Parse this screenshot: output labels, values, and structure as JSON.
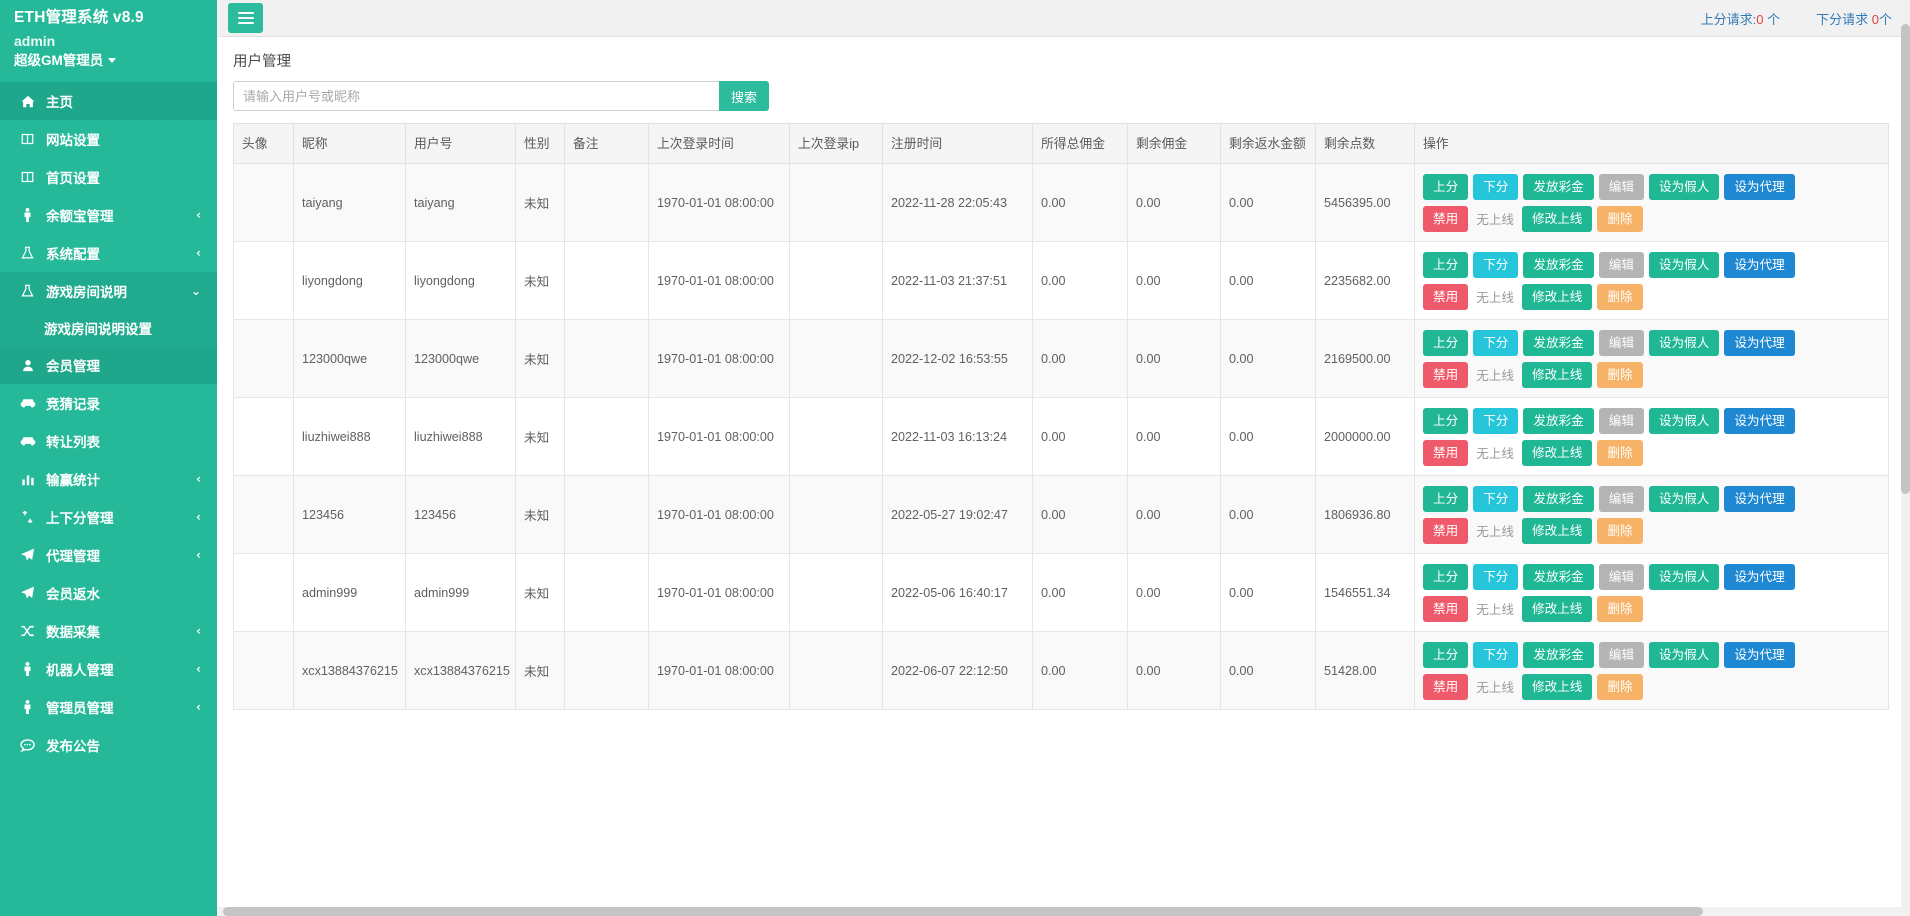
{
  "sidebar": {
    "brand": "ETH管理系统 v8.9",
    "user": "admin",
    "role": "超级GM管理员",
    "items": [
      {
        "label": "主页",
        "icon": "home-icon",
        "arrow": "",
        "active": true
      },
      {
        "label": "网站设置",
        "icon": "window-icon",
        "arrow": ""
      },
      {
        "label": "首页设置",
        "icon": "window-icon",
        "arrow": ""
      },
      {
        "label": "余额宝管理",
        "icon": "person-icon",
        "arrow": "‹"
      },
      {
        "label": "系统配置",
        "icon": "flask-icon",
        "arrow": "‹"
      },
      {
        "label": "游戏房间说明",
        "icon": "flask-icon",
        "arrow": "⌄",
        "expanded": true
      },
      {
        "label": "会员管理",
        "icon": "user-icon",
        "arrow": "",
        "active": true
      },
      {
        "label": "竞猜记录",
        "icon": "car-icon",
        "arrow": ""
      },
      {
        "label": "转让列表",
        "icon": "car-icon",
        "arrow": ""
      },
      {
        "label": "输赢统计",
        "icon": "chart-icon",
        "arrow": "‹"
      },
      {
        "label": "上下分管理",
        "icon": "updown-icon",
        "arrow": "‹"
      },
      {
        "label": "代理管理",
        "icon": "paperplane-icon",
        "arrow": "‹"
      },
      {
        "label": "会员返水",
        "icon": "paperplane-icon",
        "arrow": ""
      },
      {
        "label": "数据采集",
        "icon": "shuffle-icon",
        "arrow": "‹"
      },
      {
        "label": "机器人管理",
        "icon": "person-icon",
        "arrow": "‹"
      },
      {
        "label": "管理员管理",
        "icon": "person-icon",
        "arrow": "‹"
      },
      {
        "label": "发布公告",
        "icon": "comment-icon",
        "arrow": ""
      }
    ],
    "submenu": {
      "parent": "游戏房间说明",
      "items": [
        "游戏房间说明设置"
      ]
    }
  },
  "topbar": {
    "menu_toggle": "hamburger-icon",
    "up_request_label": "上分请求:",
    "up_request_count": "0",
    "up_request_unit": "个",
    "down_request_label": "下分请求",
    "down_request_count": "0",
    "down_request_unit": "个"
  },
  "page": {
    "title": "用户管理"
  },
  "search": {
    "placeholder": "请输入用户号或昵称",
    "value": "",
    "button": "搜索"
  },
  "table": {
    "columns": [
      "头像",
      "昵称",
      "用户号",
      "性别",
      "备注",
      "上次登录时间",
      "上次登录ip",
      "注册时间",
      "所得总佣金",
      "剩余佣金",
      "剩余返水金额",
      "剩余点数",
      "操作"
    ],
    "action_buttons": [
      {
        "label": "上分",
        "style": "btn-green"
      },
      {
        "label": "下分",
        "style": "btn-cyan"
      },
      {
        "label": "发放彩金",
        "style": "btn-green2"
      },
      {
        "label": "编辑",
        "style": "btn-gray"
      },
      {
        "label": "设为假人",
        "style": "btn-green3"
      },
      {
        "label": "设为代理",
        "style": "btn-blue"
      }
    ],
    "action_buttons2": [
      {
        "label": "禁用",
        "style": "btn-red"
      },
      {
        "label": "无上线",
        "style": "muted"
      },
      {
        "label": "修改上线",
        "style": "btn-green3"
      },
      {
        "label": "删除",
        "style": "btn-orange"
      }
    ],
    "rows": [
      {
        "avatar": "",
        "nick": "taiyang",
        "uid": "taiyang",
        "sex": "未知",
        "note": "",
        "last_login": "1970-01-01 08:00:00",
        "last_ip": "",
        "reg_time": "2022-11-28 22:05:43",
        "total_comm": "0.00",
        "rest_comm": "0.00",
        "rest_rebate": "0.00",
        "points": "5456395.00"
      },
      {
        "avatar": "",
        "nick": "liyongdong",
        "uid": "liyongdong",
        "sex": "未知",
        "note": "",
        "last_login": "1970-01-01 08:00:00",
        "last_ip": "",
        "reg_time": "2022-11-03 21:37:51",
        "total_comm": "0.00",
        "rest_comm": "0.00",
        "rest_rebate": "0.00",
        "points": "2235682.00"
      },
      {
        "avatar": "",
        "nick": "123000qwe",
        "uid": "123000qwe",
        "sex": "未知",
        "note": "",
        "last_login": "1970-01-01 08:00:00",
        "last_ip": "",
        "reg_time": "2022-12-02 16:53:55",
        "total_comm": "0.00",
        "rest_comm": "0.00",
        "rest_rebate": "0.00",
        "points": "2169500.00"
      },
      {
        "avatar": "",
        "nick": "liuzhiwei888",
        "uid": "liuzhiwei888",
        "sex": "未知",
        "note": "",
        "last_login": "1970-01-01 08:00:00",
        "last_ip": "",
        "reg_time": "2022-11-03 16:13:24",
        "total_comm": "0.00",
        "rest_comm": "0.00",
        "rest_rebate": "0.00",
        "points": "2000000.00"
      },
      {
        "avatar": "",
        "nick": "123456",
        "uid": "123456",
        "sex": "未知",
        "note": "",
        "last_login": "1970-01-01 08:00:00",
        "last_ip": "",
        "reg_time": "2022-05-27 19:02:47",
        "total_comm": "0.00",
        "rest_comm": "0.00",
        "rest_rebate": "0.00",
        "points": "1806936.80"
      },
      {
        "avatar": "",
        "nick": "admin999",
        "uid": "admin999",
        "sex": "未知",
        "note": "",
        "last_login": "1970-01-01 08:00:00",
        "last_ip": "",
        "reg_time": "2022-05-06 16:40:17",
        "total_comm": "0.00",
        "rest_comm": "0.00",
        "rest_rebate": "0.00",
        "points": "1546551.34"
      },
      {
        "avatar": "",
        "nick": "xcx13884376215",
        "uid": "xcx13884376215",
        "sex": "未知",
        "note": "",
        "last_login": "1970-01-01 08:00:00",
        "last_ip": "",
        "reg_time": "2022-06-07 22:12:50",
        "total_comm": "0.00",
        "rest_comm": "0.00",
        "rest_rebate": "0.00",
        "points": "51428.00"
      }
    ]
  },
  "colors": {
    "sidebar_bg": "#25b99a",
    "accent": "#2dbb9d",
    "link": "#337ab7",
    "alert": "#e8403a"
  }
}
